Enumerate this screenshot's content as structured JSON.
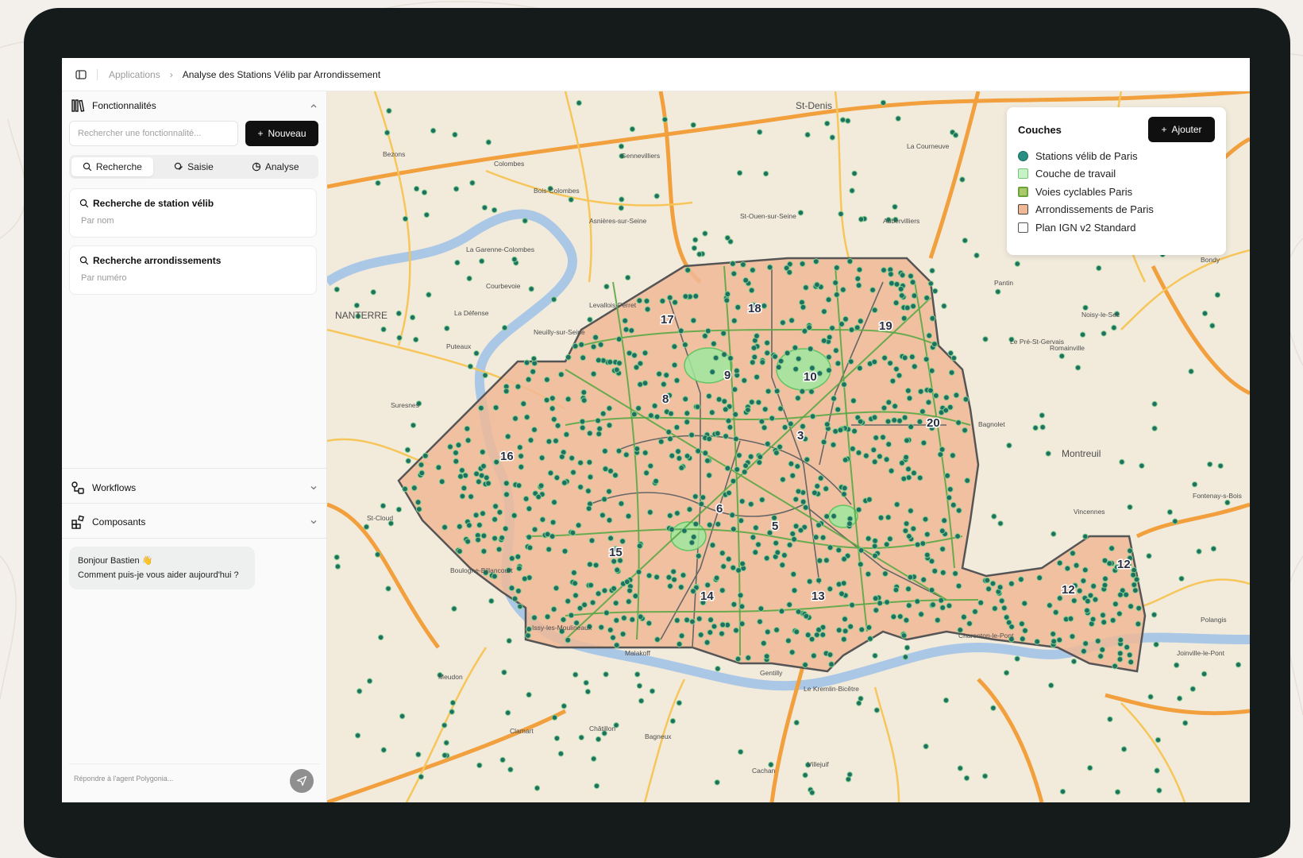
{
  "breadcrumb": {
    "root": "Applications",
    "current": "Analyse des Stations Vélib par Arrondissement"
  },
  "sidebar": {
    "features": {
      "title": "Fonctionnalités",
      "search_placeholder": "Rechercher une fonctionnalité...",
      "new_label": "Nouveau",
      "tabs": [
        {
          "label": "Recherche",
          "icon": "search-icon",
          "active": true
        },
        {
          "label": "Saisie",
          "icon": "pen-icon",
          "active": false
        },
        {
          "label": "Analyse",
          "icon": "chart-icon",
          "active": false
        }
      ],
      "cards": [
        {
          "title": "Recherche de station vélib",
          "subtitle": "Par nom"
        },
        {
          "title": "Recherche arrondissements",
          "subtitle": "Par numéro"
        }
      ]
    },
    "workflows": {
      "title": "Workflows"
    },
    "components": {
      "title": "Composants"
    },
    "chat": {
      "greeting": "Bonjour Bastien 👋",
      "message": "Comment puis-je vous aider aujourd'hui ?",
      "input_placeholder": "Répondre à l'agent Polygonia..."
    }
  },
  "layers_panel": {
    "title": "Couches",
    "add_label": "Ajouter",
    "layers": [
      {
        "label": "Stations vélib de Paris",
        "color": "#2a8f83",
        "shape": "circle"
      },
      {
        "label": "Couche de travail",
        "color": "#c6f2c6",
        "shape": "square"
      },
      {
        "label": "Voies cyclables Paris",
        "color": "#6da33b",
        "shape": "square"
      },
      {
        "label": "Arrondissements de Paris",
        "color": "#f1b896",
        "shape": "square"
      },
      {
        "label": "Plan IGN v2 Standard",
        "color": "#ffffff",
        "shape": "checkbox"
      }
    ]
  },
  "map": {
    "place_labels": [
      "St-Denis",
      "Bezons",
      "Colombes",
      "Gennevilliers",
      "Bois-Colombes",
      "Asnières-sur-Seine",
      "St-Ouen-sur-Seine",
      "Aubervilliers",
      "La Courneuve",
      "La Garenne-Colombes",
      "Courbevoie",
      "NANTERRE",
      "La Défense",
      "Levallois-Perret",
      "Neuilly-sur-Seine",
      "Puteaux",
      "Suresnes",
      "Pantin",
      "Noisy-le-Sec",
      "Le Pré-St-Gervais",
      "Romainville",
      "Bagnolet",
      "Montreuil",
      "Fontenay-s-Bois",
      "Vincennes",
      "St-Cloud",
      "Boulogne-Billancourt",
      "Issy-les-Moulineaux",
      "Malakoff",
      "Meudon",
      "Gentilly",
      "Le Kremlin-Bicêtre",
      "Charenton-le-Pont",
      "Joinville-le-Pont",
      "Polangis",
      "Clamart",
      "Châtillon",
      "Bagneux",
      "Villejuif",
      "Cachan",
      "Bondy"
    ],
    "arrondissement_labels": [
      "17",
      "18",
      "19",
      "16",
      "20",
      "8",
      "9",
      "10",
      "3",
      "6",
      "5",
      "15",
      "14",
      "13",
      "12",
      "12"
    ],
    "colors": {
      "background": "#f2ebdc",
      "arrondissement_fill": "#f1b896",
      "boundary": "#555555",
      "station": "#1f6f63",
      "station_stroke": "#7fd08a",
      "bike_lane": "#59a845",
      "work_layer": "#9fe89f",
      "major_road": "#f2a03d",
      "secondary_road": "#f6c65a",
      "river": "#aac7e6"
    }
  }
}
